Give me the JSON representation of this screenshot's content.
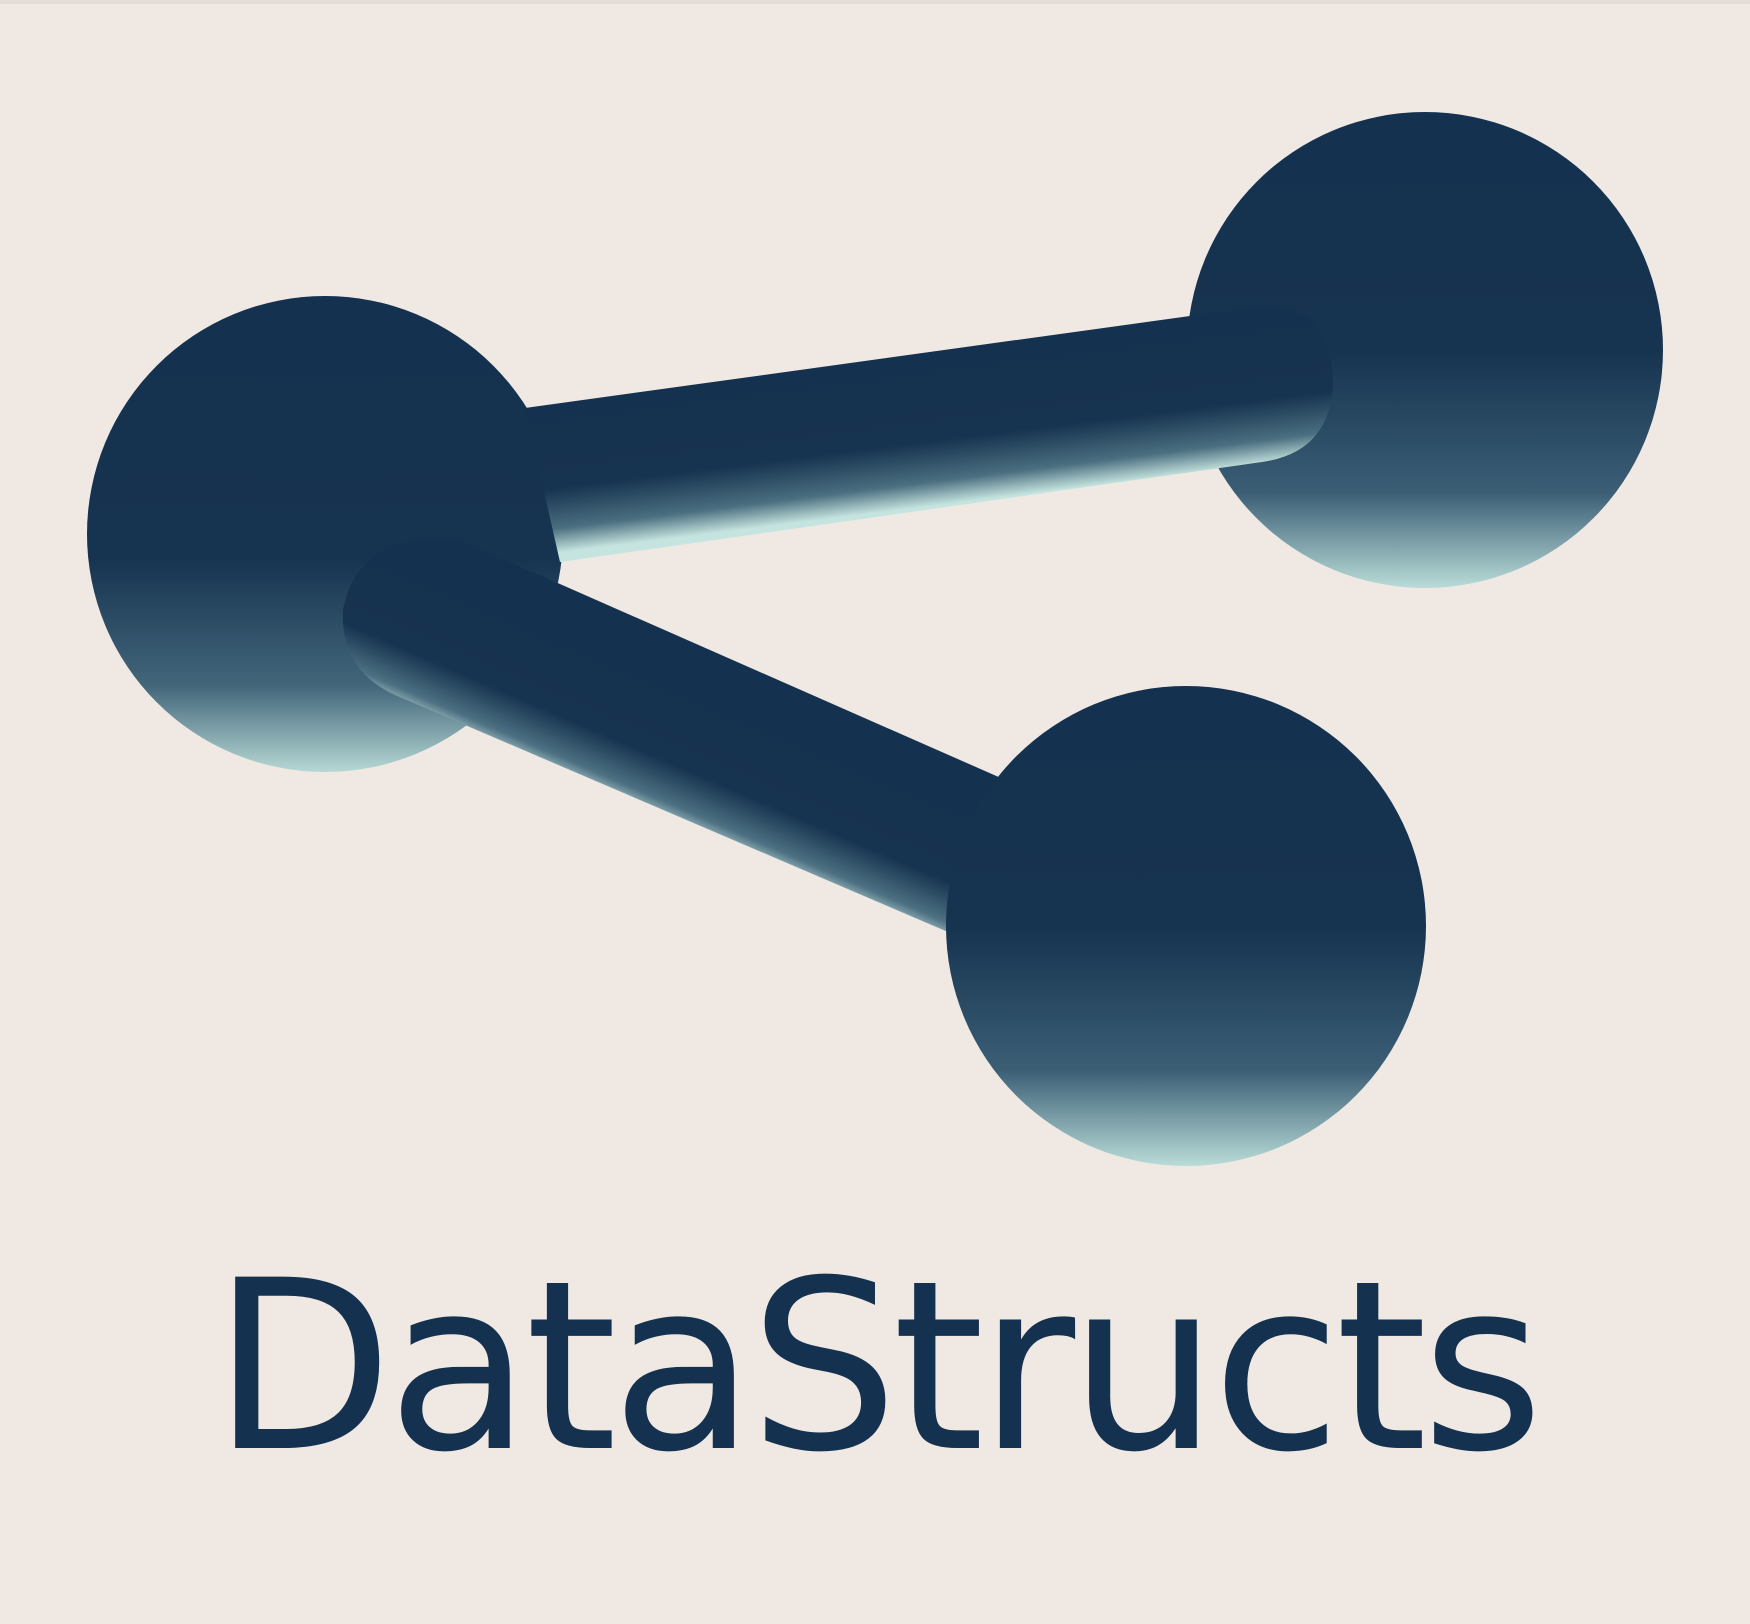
{
  "logo": {
    "wordmark": "DataStructs",
    "icon": "connected-nodes-icon",
    "colors": {
      "background": "#efe8e3",
      "primary": "#14314f",
      "highlight": "#b9dcd8"
    }
  }
}
